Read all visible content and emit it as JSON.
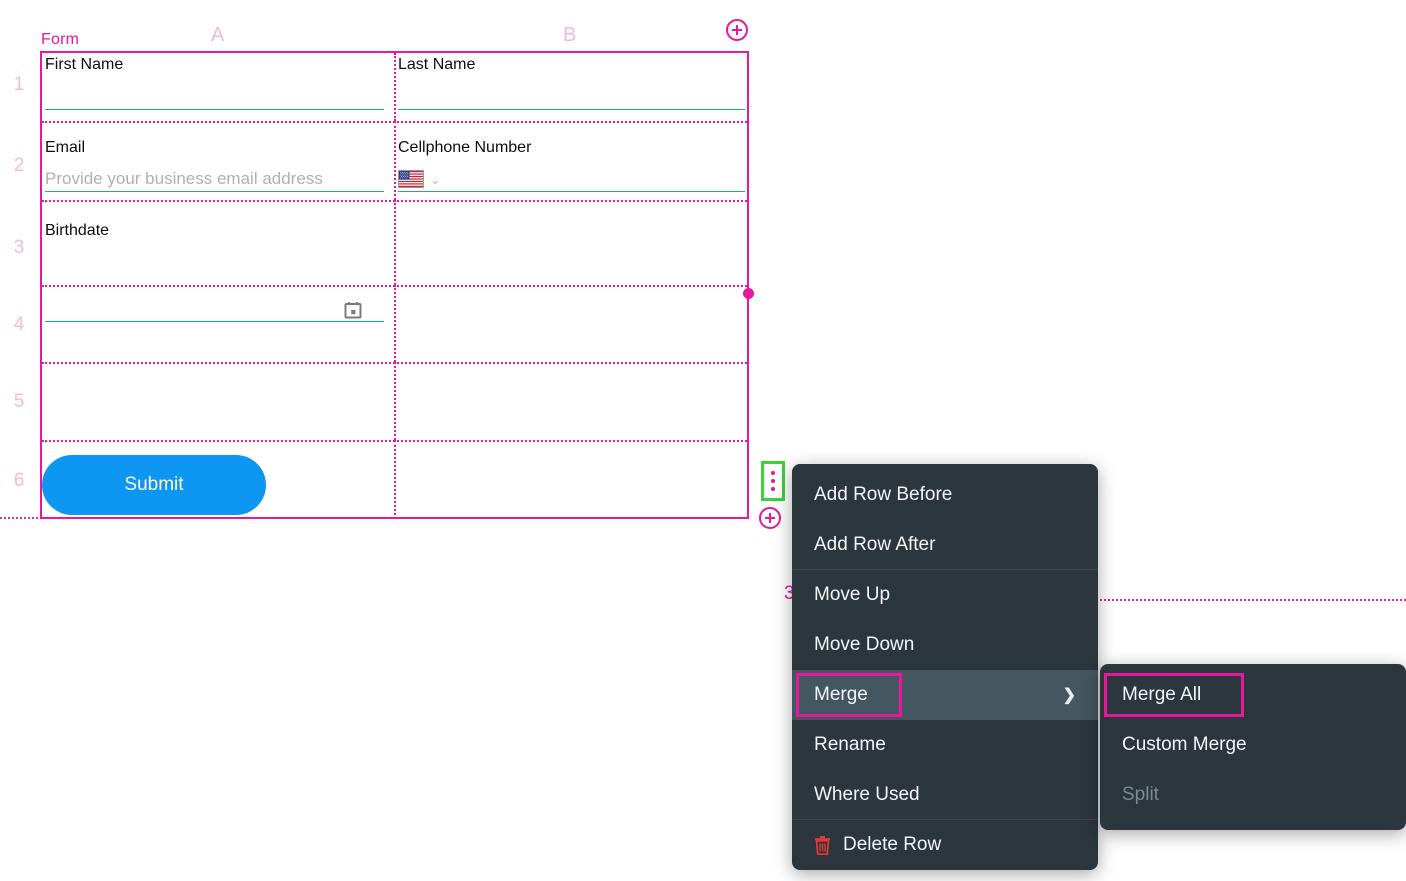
{
  "form": {
    "title": "Form",
    "columns": [
      {
        "id": "A",
        "label": "A"
      },
      {
        "id": "B",
        "label": "B"
      }
    ],
    "rows": [
      {
        "number": "1"
      },
      {
        "number": "2"
      },
      {
        "number": "3"
      },
      {
        "number": "4"
      },
      {
        "number": "5"
      },
      {
        "number": "6"
      }
    ],
    "ghost_row_number": "3",
    "fields": {
      "first_name": {
        "label": "First Name",
        "value": "",
        "placeholder": ""
      },
      "last_name": {
        "label": "Last Name",
        "value": "",
        "placeholder": ""
      },
      "email": {
        "label": "Email",
        "value": "",
        "placeholder": "Provide your business email address"
      },
      "cellphone": {
        "label": "Cellphone Number",
        "value": "",
        "country_flag": "us-flag-icon",
        "chevron": "⌄"
      },
      "birthdate": {
        "label": "Birthdate",
        "value": "",
        "icon": "calendar-icon"
      }
    },
    "submit": {
      "label": "Submit"
    },
    "add_row_top_tooltip": "Add",
    "add_row_bottom_tooltip": "Add"
  },
  "context_menu": {
    "items": [
      {
        "id": "add-row-before",
        "label": "Add Row Before",
        "separator_after": false,
        "highlighted": false,
        "disabled": false,
        "has_submenu": false,
        "outlined": false
      },
      {
        "id": "add-row-after",
        "label": "Add Row After",
        "separator_after": true,
        "highlighted": false,
        "disabled": false,
        "has_submenu": false,
        "outlined": false
      },
      {
        "id": "move-up",
        "label": "Move Up",
        "separator_after": false,
        "highlighted": false,
        "disabled": false,
        "has_submenu": false,
        "outlined": false
      },
      {
        "id": "move-down",
        "label": "Move Down",
        "separator_after": false,
        "highlighted": false,
        "disabled": false,
        "has_submenu": false,
        "outlined": false
      },
      {
        "id": "merge",
        "label": "Merge",
        "separator_after": false,
        "highlighted": true,
        "disabled": false,
        "has_submenu": true,
        "outlined": true,
        "chevron": "❯"
      },
      {
        "id": "rename",
        "label": "Rename",
        "separator_after": false,
        "highlighted": false,
        "disabled": false,
        "has_submenu": false,
        "outlined": false
      },
      {
        "id": "where-used",
        "label": "Where Used",
        "separator_after": true,
        "highlighted": false,
        "disabled": false,
        "has_submenu": false,
        "outlined": false
      },
      {
        "id": "delete-row",
        "label": "Delete Row",
        "separator_after": false,
        "highlighted": false,
        "disabled": false,
        "has_submenu": false,
        "outlined": false,
        "icon": "trash-icon"
      }
    ]
  },
  "sub_menu": {
    "items": [
      {
        "id": "merge-all",
        "label": "Merge All",
        "disabled": false,
        "outlined": true
      },
      {
        "id": "custom-merge",
        "label": "Custom Merge",
        "disabled": false,
        "outlined": false
      },
      {
        "id": "split",
        "label": "Split",
        "disabled": true,
        "outlined": false
      }
    ]
  },
  "colors": {
    "grid_accent": "#e6189c",
    "column_header": "#f2b9d8",
    "menu_bg": "#2b363d",
    "menu_highlight": "#44565f",
    "submit_blue": "#0d96f2",
    "field_underline": "#2196f3",
    "selection_green": "#3ad13a",
    "danger_red": "#e53935",
    "placeholder_gray": "#b0b0b0"
  }
}
